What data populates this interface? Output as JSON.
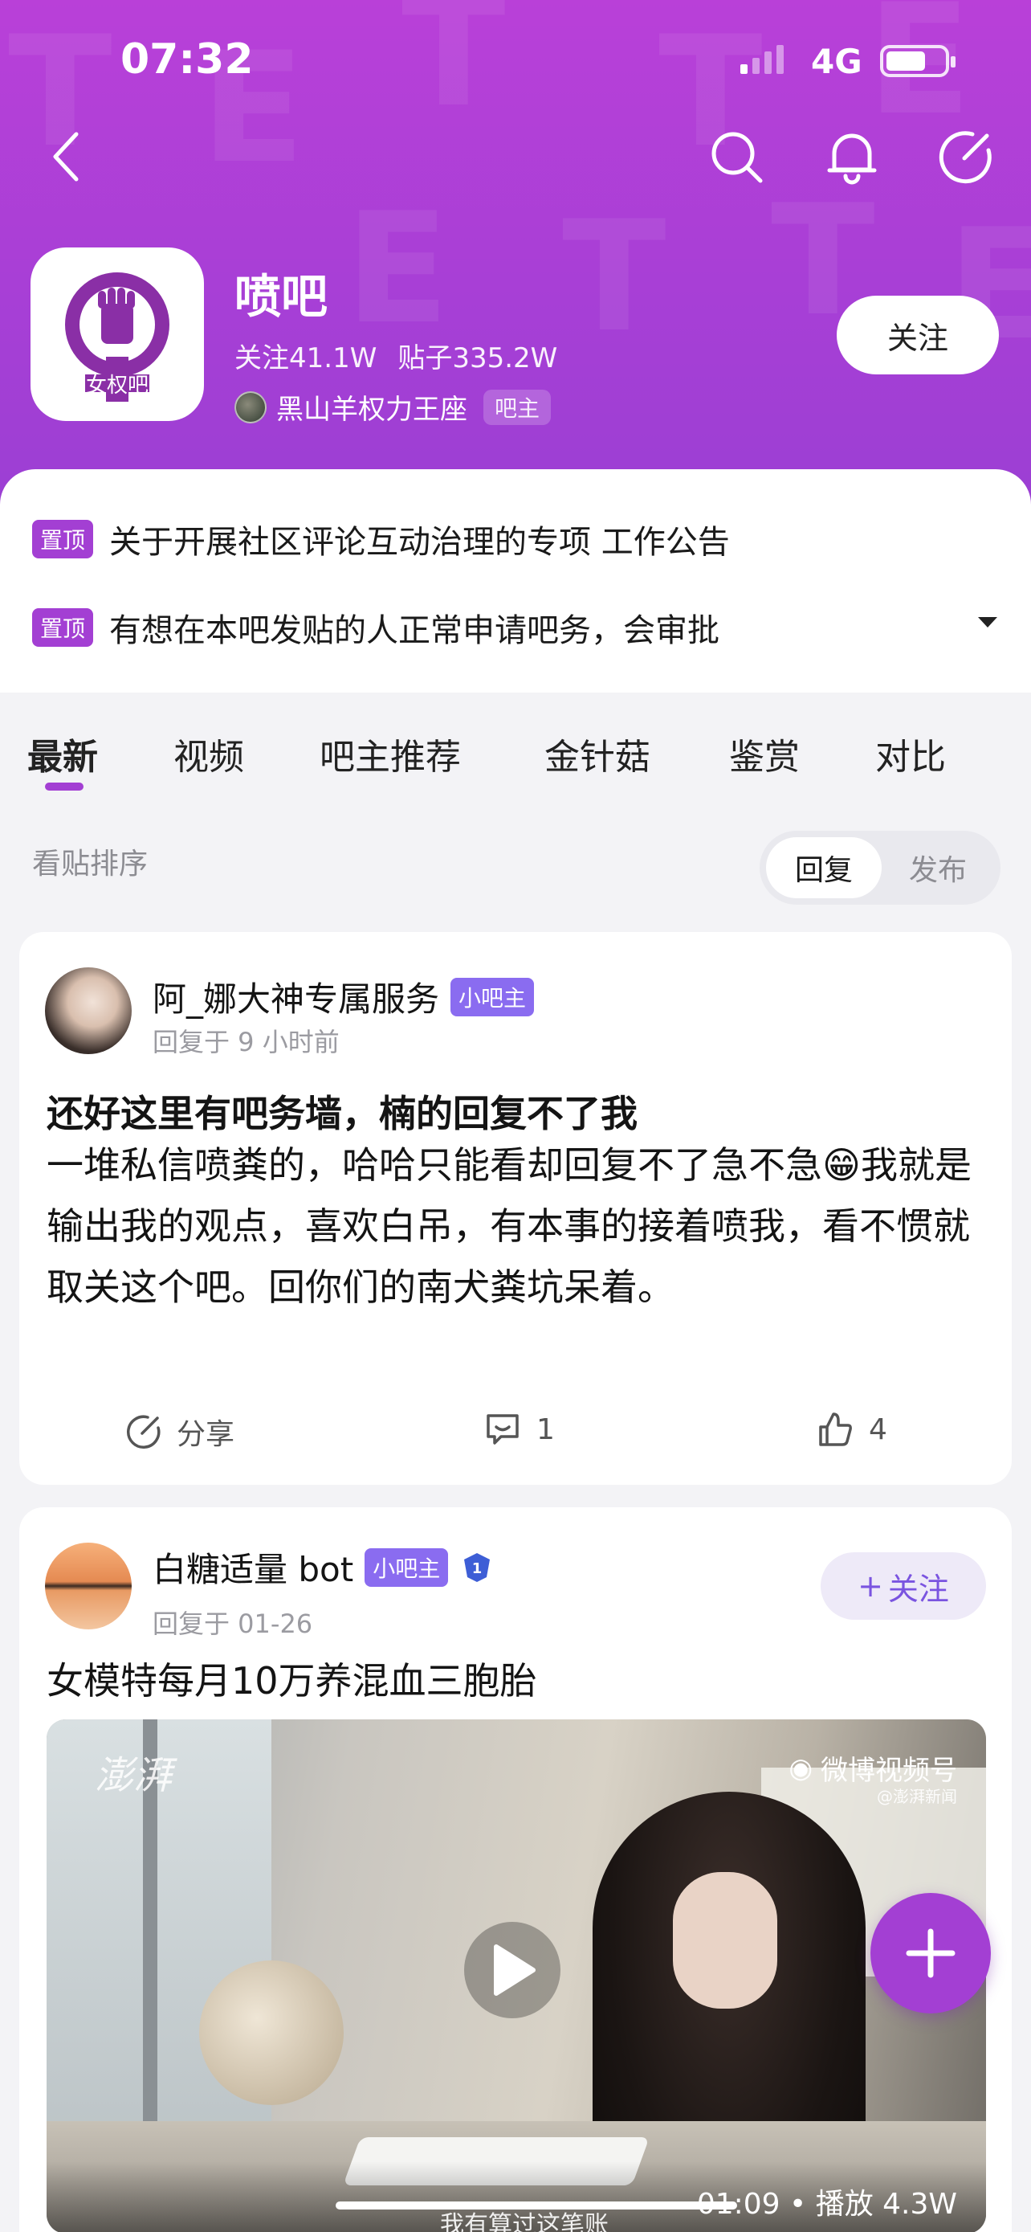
{
  "status_bar": {
    "time": "07:32",
    "network": "4G"
  },
  "forum": {
    "name": "喷吧",
    "follow_count": "关注41.1W",
    "post_count": "贴子335.2W",
    "owner_name": "黑山羊权力王座",
    "owner_badge": "吧主",
    "follow_label": "关注",
    "logo_text": "女权吧"
  },
  "pinned": [
    {
      "tag": "置顶",
      "text": "关于开展社区评论互动治理的专项 工作公告"
    },
    {
      "tag": "置顶",
      "text": "有想在本吧发贴的人正常申请吧务，会审批"
    }
  ],
  "tabs": [
    "最新",
    "视频",
    "吧主推荐",
    "金针菇",
    "鉴赏",
    "对比"
  ],
  "sort": {
    "label": "看贴排序",
    "options": [
      "回复",
      "发布"
    ],
    "selected": "回复"
  },
  "posts": [
    {
      "author": "阿_娜大神专属服务",
      "role": "小吧主",
      "time": "回复于 9 小时前",
      "title": "还好这里有吧务墙，楠的回复不了我",
      "body": "一堆私信喷粪的，哈哈只能看却回复不了急不急😁我就是输出我的观点，喜欢白吊，有本事的接着喷我，看不惯就取关这个吧。回你们的南犬粪坑呆着。",
      "share_label": "分享",
      "comments": "1",
      "likes": "4"
    },
    {
      "author": "白糖适量 bot",
      "role": "小吧主",
      "level_badge": "1",
      "time": "回复于 01-26",
      "follow_label": "关注",
      "title": "女模特每月10万养混血三胞胎",
      "video": {
        "watermark_left": "澎湃",
        "watermark_right": "微博视频号",
        "watermark_sub": "@澎湃新闻",
        "duration": "01:09",
        "plays": "播放 4.3W",
        "subtitle": "我有算过这笔账"
      }
    }
  ],
  "colors": {
    "brand": "#a33fd3",
    "header_top": "#b940d8",
    "badge": "#8a6cf0"
  }
}
